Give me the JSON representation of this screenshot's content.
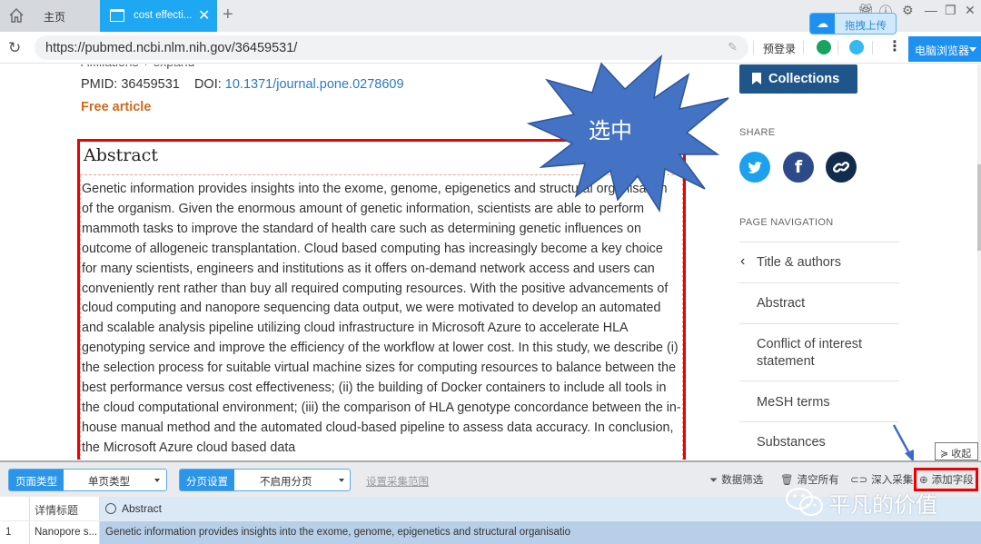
{
  "browser": {
    "home_tab_label": "主页",
    "active_tab_label": "cost effecti...",
    "url": "https://pubmed.ncbi.nlm.nih.gov/36459531/",
    "prelogin_label": "预登录",
    "browser_mode_label": "电脑浏览器",
    "upload_label": "拖拽上传",
    "accent_color": "#1ea7f2"
  },
  "article": {
    "affiliations_partial": "Affiliations  +  expand",
    "pmid_label": "PMID:",
    "pmid": "36459531",
    "doi_label": "DOI:",
    "doi": "10.1371/journal.pone.0278609",
    "free_article": "Free article",
    "abstract_heading": "Abstract",
    "abstract_text": "Genetic information provides insights into the exome, genome, epigenetics and structural organisation of the organism. Given the enormous amount of genetic information, scientists are able to perform mammoth tasks to improve the standard of health care such as determining genetic influences on outcome of allogeneic transplantation. Cloud based computing has increasingly become a key choice for many scientists, engineers and institutions as it offers on-demand network access and users can conveniently rent rather than buy all required computing resources. With the positive advancements of cloud computing and nanopore sequencing data output, we were motivated to develop an automated and scalable analysis pipeline utilizing cloud infrastructure in Microsoft Azure to accelerate HLA genotyping service and improve the efficiency of the workflow at lower cost. In this study, we describe (i) the selection process for suitable virtual machine sizes for computing resources to balance between the best performance versus cost effectiveness; (ii) the building of Docker containers to include all tools in the cloud computational environment; (iii) the comparison of HLA genotype concordance between the in-house manual method and the automated cloud-based pipeline to assess data accuracy. In conclusion, the Microsoft Azure cloud based data"
  },
  "sidebar": {
    "collections_label": "Collections",
    "share_label": "SHARE",
    "share_buttons": [
      "twitter",
      "facebook",
      "permalink"
    ],
    "page_nav_label": "PAGE NAVIGATION",
    "nav_items": [
      {
        "label": "Title & authors"
      },
      {
        "label": "Abstract"
      },
      {
        "label": "Conflict of interest statement"
      },
      {
        "label": "MeSH terms"
      },
      {
        "label": "Substances"
      }
    ]
  },
  "annotation": {
    "starburst_label": "选中"
  },
  "scraper": {
    "collapse_label": "收起",
    "page_type_tag": "页面类型",
    "page_type_value": "单页类型",
    "pagination_tag": "分页设置",
    "pagination_value": "不启用分页",
    "set_range_link": "设置采集范围",
    "tools": {
      "filter": "数据筛选",
      "clear_all": "清空所有",
      "deep_collect": "深入采集",
      "add_field": "添加字段"
    },
    "columns": [
      "详情标题",
      "Abstract"
    ],
    "rows": [
      {
        "index": "1",
        "title": "Nanopore s...",
        "abstract": "Genetic information provides insights into the exome, genome, epigenetics and structural organisatio"
      }
    ]
  },
  "watermark": {
    "text": "平凡的价值"
  }
}
